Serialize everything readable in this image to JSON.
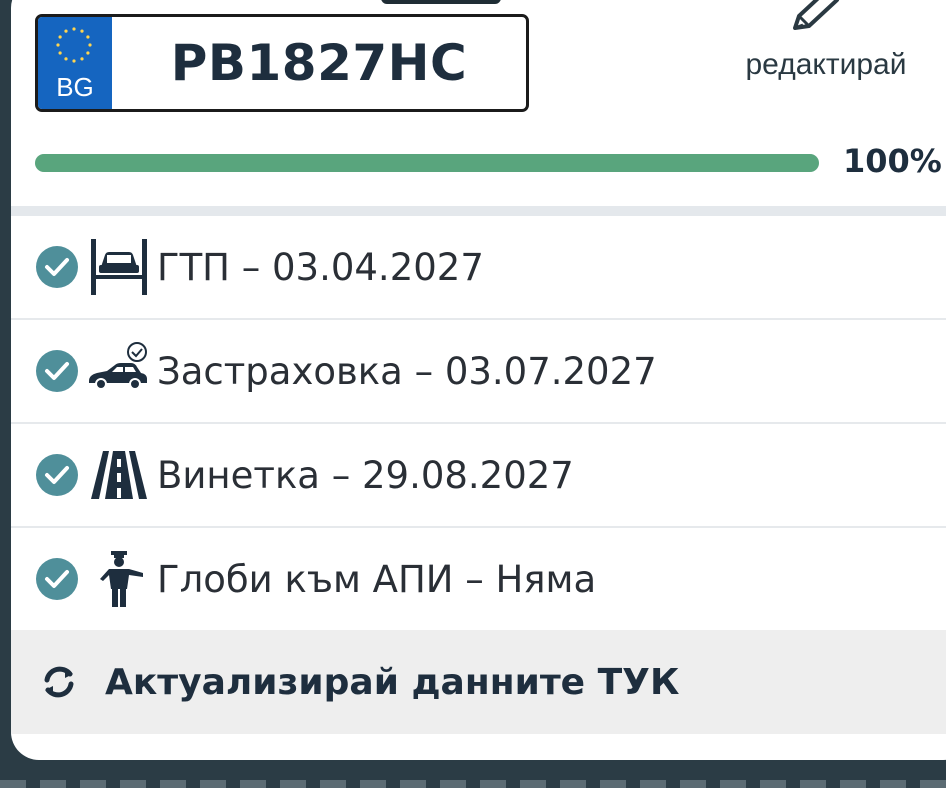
{
  "plate": {
    "country_code": "BG",
    "number": "PB1827HC"
  },
  "edit": {
    "label": "редактирай",
    "icon": "pencil-icon"
  },
  "progress": {
    "percent_label": "100%",
    "value": 1.0,
    "color": "#59a57d"
  },
  "items": [
    {
      "icon": "car-lift-icon",
      "text": "ГТП – 03.04.2027",
      "status": "ok"
    },
    {
      "icon": "car-insurance-icon",
      "text": "Застраховка – 03.07.2027",
      "status": "ok"
    },
    {
      "icon": "road-icon",
      "text": "Винетка – 29.08.2027",
      "status": "ok"
    },
    {
      "icon": "traffic-officer-icon",
      "text": "Глоби към АПИ – Няма",
      "status": "ok"
    }
  ],
  "refresh": {
    "label": "Актуализирай данните ТУК",
    "icon": "refresh-icon"
  },
  "colors": {
    "check": "#4f8f9a",
    "plate_eu": "#1565c0",
    "text": "#1e2e3e"
  }
}
